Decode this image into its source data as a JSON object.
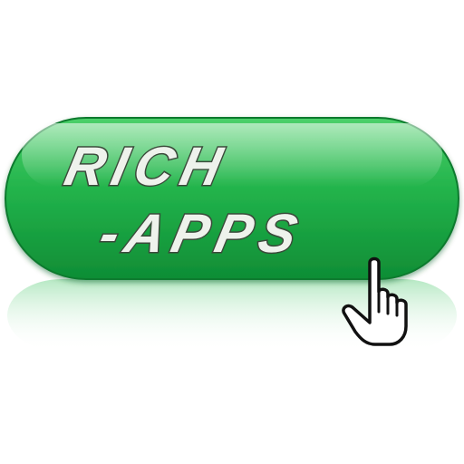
{
  "button": {
    "line1": "RICH",
    "line2": "-APPS"
  },
  "colors": {
    "green_light": "#5fd87a",
    "green_mid": "#1fb24a",
    "green_dark": "#0e8a34",
    "text_fill": "#eef2ec",
    "text_stroke": "#3a4a3a"
  },
  "icons": {
    "cursor": "hand-pointer-icon"
  }
}
